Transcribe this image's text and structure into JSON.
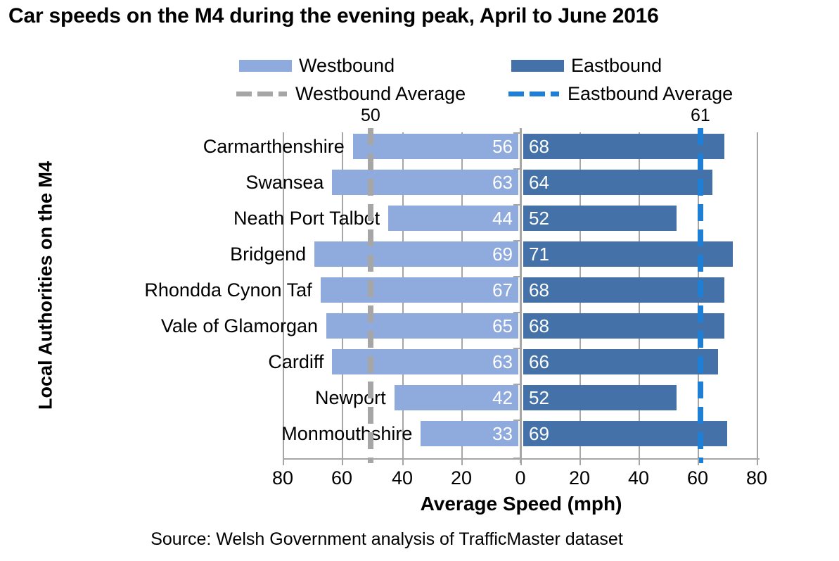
{
  "chart_data": {
    "type": "bar",
    "orientation": "horizontal",
    "style": "diverging-bidirectional",
    "title": "Car speeds on the M4 during the evening peak, April to June 2016",
    "xlabel": "Average Speed (mph)",
    "ylabel": "Local Authorities on the M4",
    "source": "Source: Welsh Government analysis of TrafficMaster dataset",
    "categories": [
      "Carmarthenshire",
      "Swansea",
      "Neath Port Talbot",
      "Bridgend",
      "Rhondda Cynon Taf",
      "Vale of Glamorgan",
      "Cardiff",
      "Newport",
      "Monmouthshire"
    ],
    "series": [
      {
        "name": "Westbound",
        "color": "#8faadc",
        "side": "left",
        "values": [
          56,
          63,
          44,
          69,
          67,
          65,
          63,
          42,
          33
        ]
      },
      {
        "name": "Eastbound",
        "color": "#4472a8",
        "side": "right",
        "values": [
          68,
          64,
          52,
          71,
          68,
          68,
          66,
          52,
          69
        ]
      }
    ],
    "reference_lines": [
      {
        "name": "Westbound Average",
        "value": 50,
        "label": "50",
        "color": "#a6a6a6",
        "side": "left",
        "style": "dashed"
      },
      {
        "name": "Eastbound Average",
        "value": 61,
        "label": "61",
        "color": "#1f7fd4",
        "side": "right",
        "style": "dashed"
      }
    ],
    "xticks_left": [
      "80",
      "60",
      "40",
      "20"
    ],
    "xticks_center": "0",
    "xticks_right": [
      "20",
      "40",
      "60",
      "80"
    ],
    "xlim": [
      80,
      80
    ],
    "grid": true,
    "legend_position": "top"
  },
  "legend": {
    "westbound": "Westbound",
    "eastbound": "Eastbound",
    "westbound_average": "Westbound Average",
    "eastbound_average": "Eastbound Average"
  },
  "averages": {
    "westbound_label": "50",
    "eastbound_label": "61"
  },
  "axis": {
    "x_title": "Average Speed (mph)",
    "y_title": "Local Authorities on the M4",
    "ticks": [
      "80",
      "60",
      "40",
      "20",
      "0",
      "20",
      "40",
      "60",
      "80"
    ]
  },
  "footer": {
    "source": "Source: Welsh Government analysis of TrafficMaster dataset"
  },
  "colors": {
    "westbound": "#8faadc",
    "eastbound": "#4472a8",
    "westbound_average": "#a6a6a6",
    "eastbound_average": "#1f7fd4",
    "grid": "#a6a6a6"
  }
}
